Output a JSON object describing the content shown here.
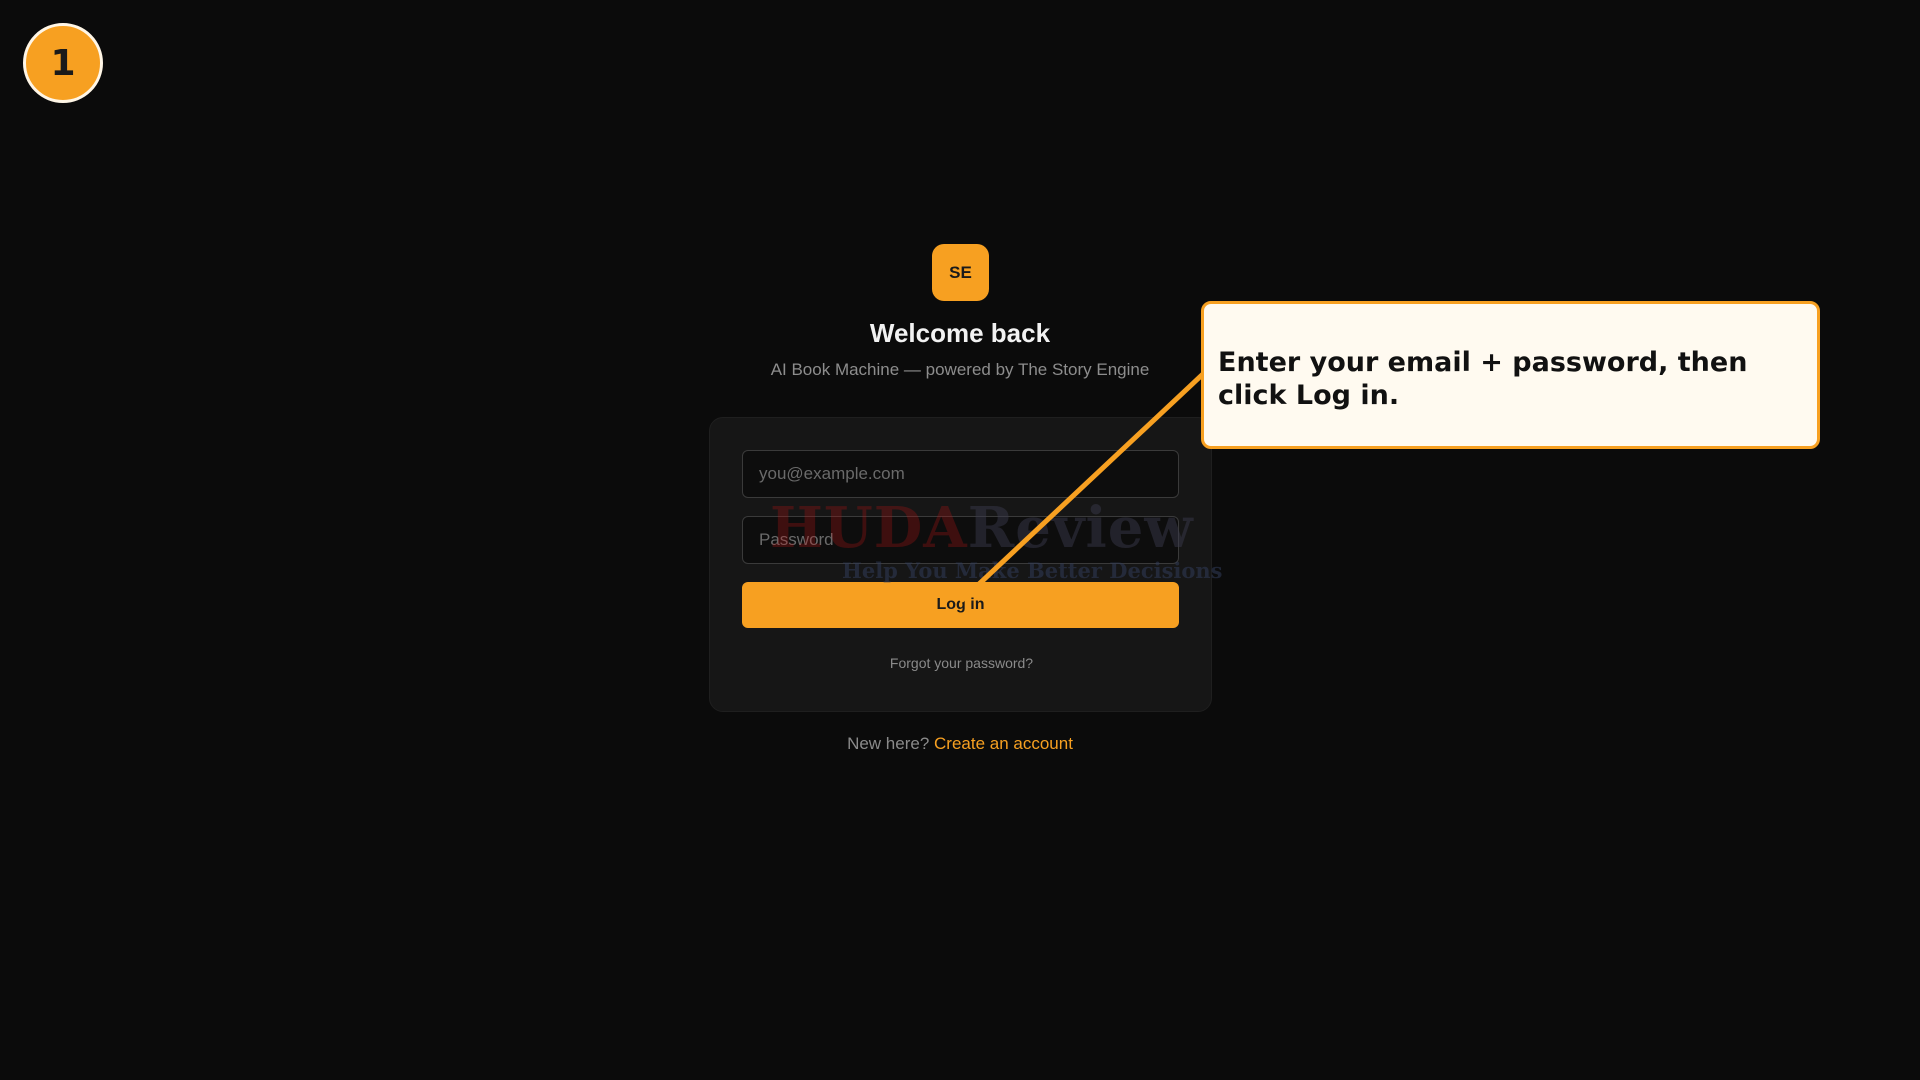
{
  "tutorial": {
    "step_number": "1",
    "callout_text": "Enter your email + password, then click Log in."
  },
  "brand": {
    "logo_text": "SE",
    "accent_color": "#f7a021"
  },
  "login": {
    "title": "Welcome back",
    "subtitle": "AI Book Machine — powered by The Story Engine",
    "email_placeholder": "you@example.com",
    "password_placeholder": "Password",
    "login_label": "Log in",
    "forgot_label": "Forgot your password?",
    "signup_prompt": "New here?",
    "signup_link": "Create an account"
  },
  "watermark": {
    "name_a": "HUDA",
    "name_b": "Review",
    "tagline": "Help You Make Better Decisions"
  }
}
